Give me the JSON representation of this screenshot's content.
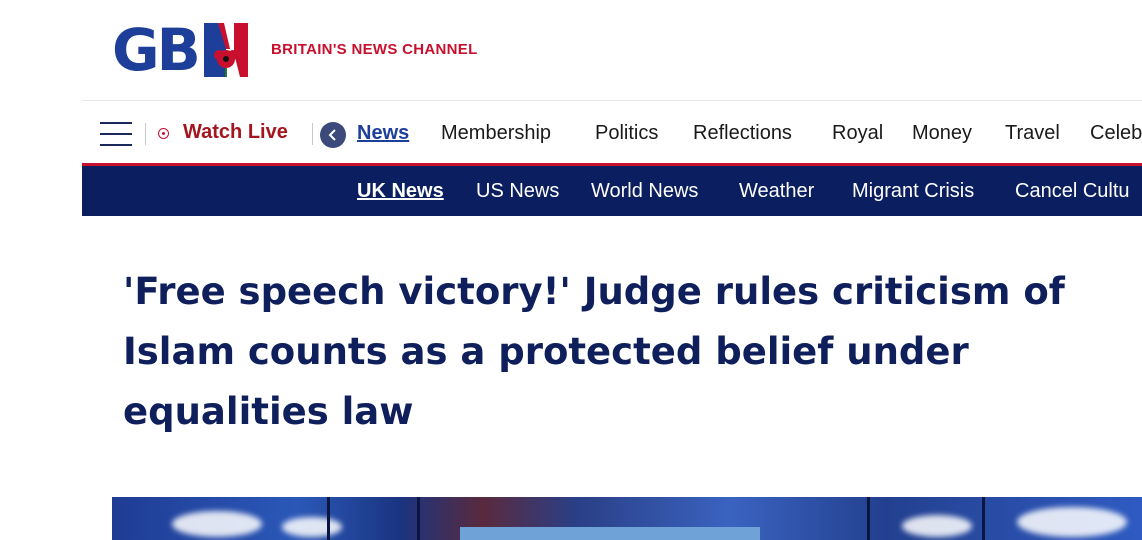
{
  "brand": {
    "logo_text": "GB",
    "tagline": "BRITAIN'S NEWS CHANNEL",
    "colors": {
      "navy": "#0b1f60",
      "blue": "#1d3f9a",
      "red": "#c8102e"
    }
  },
  "primary_nav": {
    "menu_icon": "hamburger-menu-icon",
    "watch_live_label": "Watch Live",
    "back_icon": "chevron-left-icon",
    "items": [
      {
        "label": "News",
        "active": true
      },
      {
        "label": "Membership"
      },
      {
        "label": "Politics"
      },
      {
        "label": "Reflections"
      },
      {
        "label": "Royal"
      },
      {
        "label": "Money"
      },
      {
        "label": "Travel"
      },
      {
        "label": "Celeb"
      }
    ]
  },
  "secondary_nav": {
    "items": [
      {
        "label": "UK News",
        "active": true
      },
      {
        "label": "US News"
      },
      {
        "label": "World News"
      },
      {
        "label": "Weather"
      },
      {
        "label": "Migrant Crisis"
      },
      {
        "label": "Cancel Cultu"
      }
    ]
  },
  "article": {
    "headline": "'Free speech victory!' Judge rules criticism of Islam counts as a protected belief under equalities law"
  }
}
